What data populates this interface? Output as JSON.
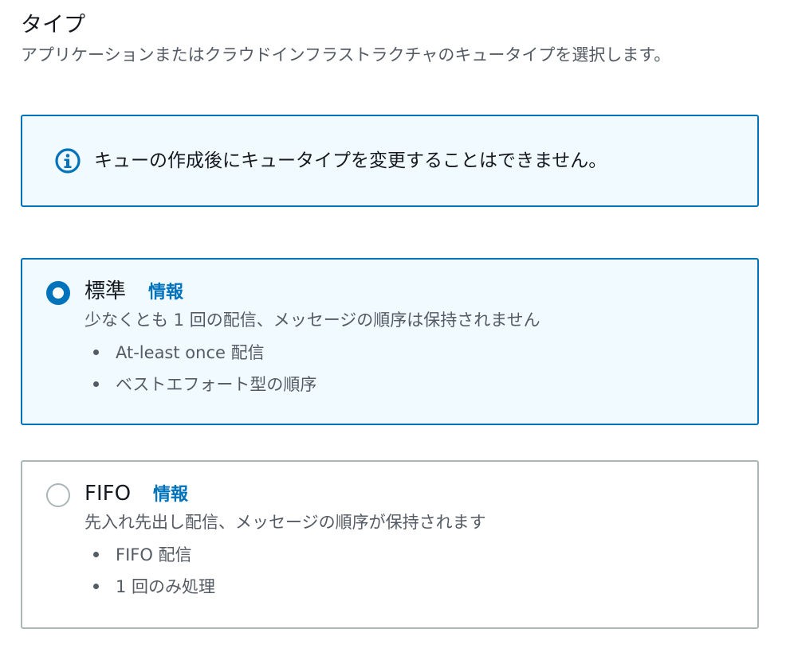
{
  "type_section": {
    "title": "タイプ",
    "description": "アプリケーションまたはクラウドインフラストラクチャのキュータイプを選択します。"
  },
  "alert": {
    "icon": "info-icon",
    "text": "キューの作成後にキュータイプを変更することはできません。"
  },
  "options": [
    {
      "title": "標準",
      "info_label": "情報",
      "description": "少なくとも 1 回の配信、メッセージの順序は保持されません",
      "bullets": [
        "At-least once 配信",
        "ベストエフォート型の順序"
      ],
      "selected": true
    },
    {
      "title": "FIFO",
      "info_label": "情報",
      "description": "先入れ先出し配信、メッセージの順序が保持されます",
      "bullets": [
        "FIFO 配信",
        "1 回のみ処理"
      ],
      "selected": false
    }
  ],
  "colors": {
    "accent": "#0073bb",
    "selected_background": "#f1faff",
    "muted_text": "#545b64",
    "unselected_border": "#aab7b8"
  }
}
